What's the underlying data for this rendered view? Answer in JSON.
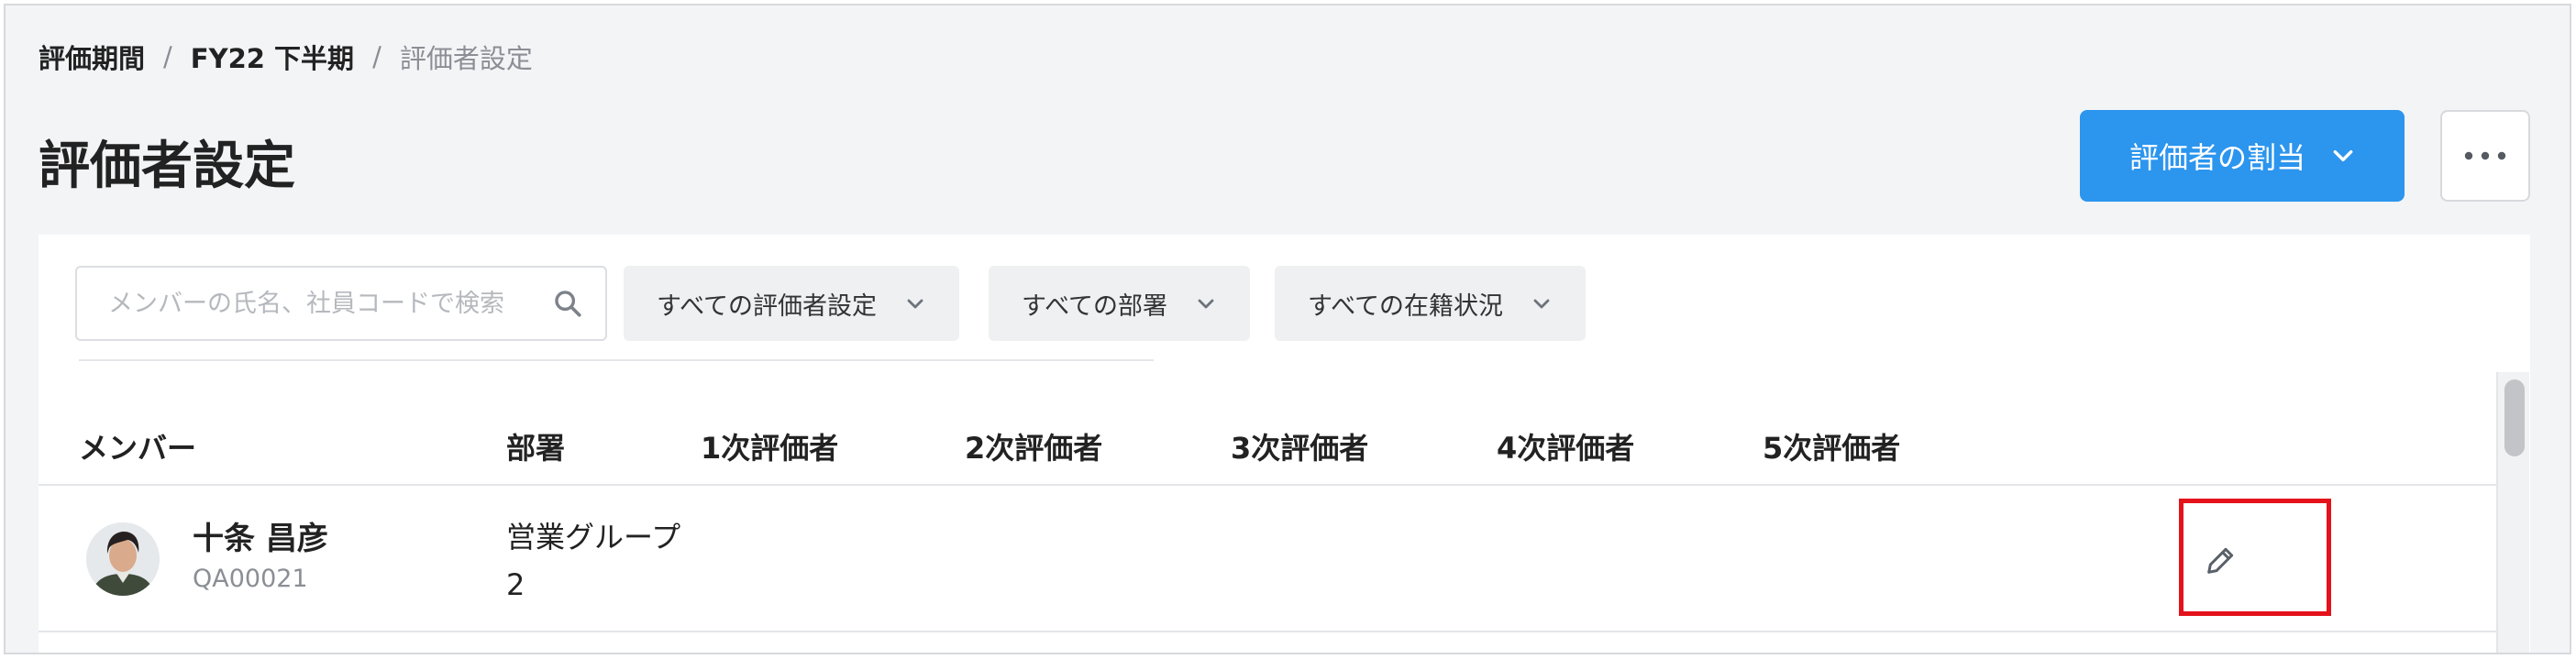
{
  "breadcrumb": {
    "items": [
      "評価期間",
      "FY22 下半期",
      "評価者設定"
    ],
    "separator": "/"
  },
  "page_title": "評価者設定",
  "actions": {
    "assign_label": "評価者の割当",
    "assign_icon": "chevron-down-icon",
    "more_icon": "more-horizontal-icon"
  },
  "filters": {
    "search_placeholder": "メンバーの氏名、社員コードで検索",
    "search_value": "",
    "evaluator_setting": "すべての評価者設定",
    "department": "すべての部署",
    "enrollment_status": "すべての在籍状況"
  },
  "table": {
    "columns": [
      "メンバー",
      "部署",
      "1次評価者",
      "2次評価者",
      "3次評価者",
      "4次評価者",
      "5次評価者"
    ],
    "rows": [
      {
        "name": "十条 昌彦",
        "code": "QA00021",
        "department": "営業グループ2",
        "evaluators": [
          "",
          "",
          "",
          "",
          ""
        ],
        "edit_icon": "pencil-icon"
      }
    ]
  },
  "colors": {
    "primary": "#2c95ee",
    "highlight": "#e3121b",
    "background": "#f3f4f6",
    "muted_text": "#8b8e94"
  }
}
